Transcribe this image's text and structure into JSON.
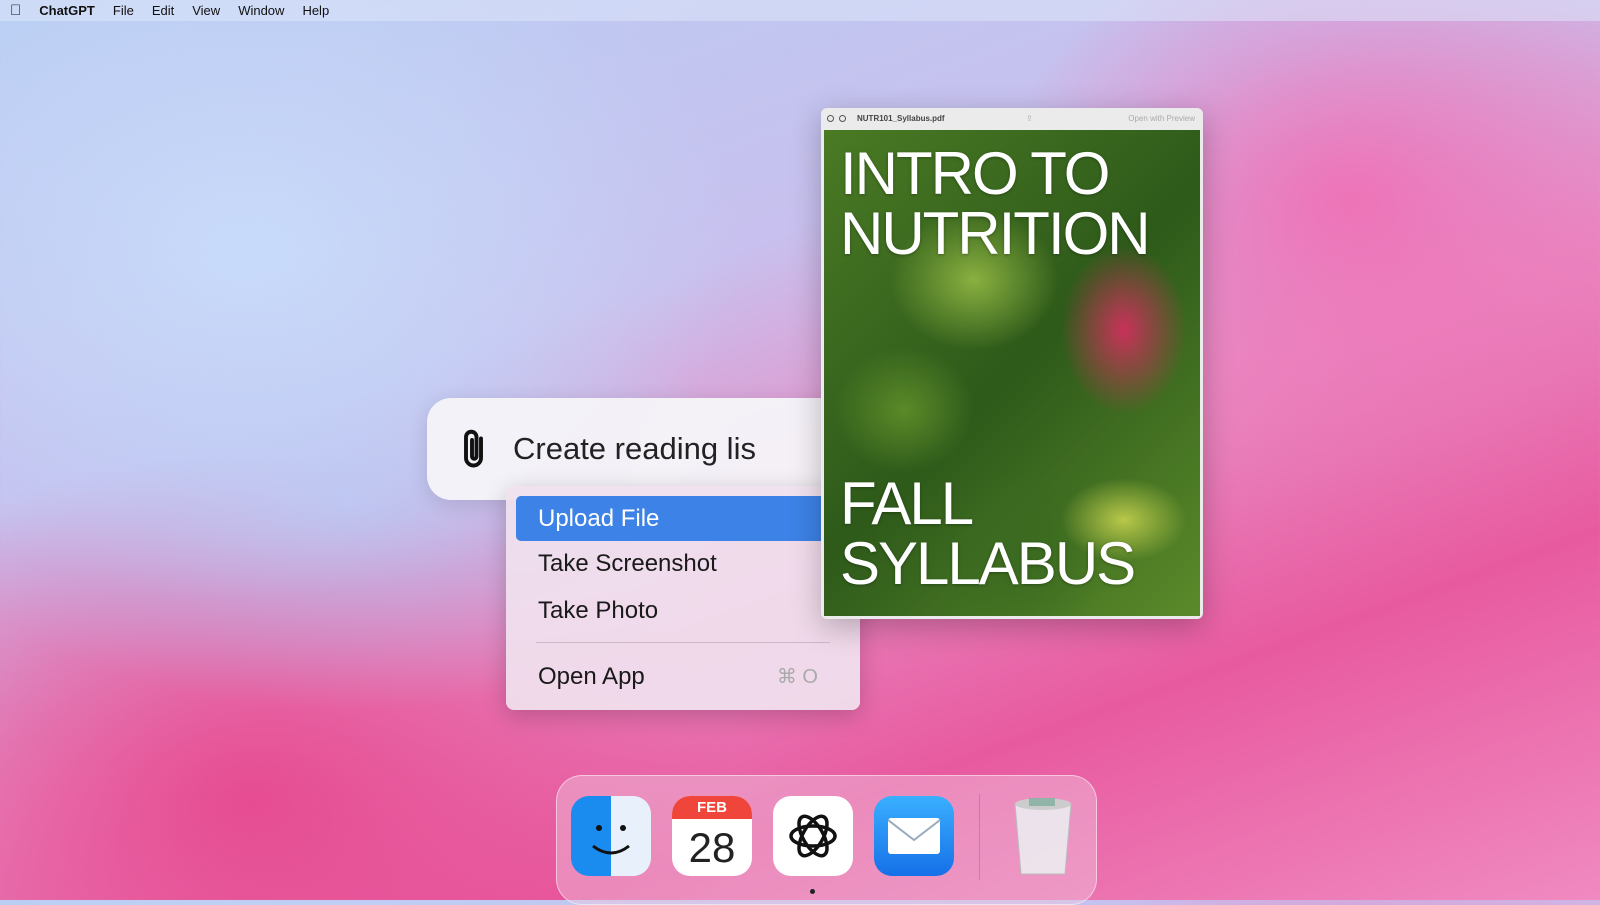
{
  "menubar": {
    "app": "ChatGPT",
    "items": [
      "File",
      "Edit",
      "View",
      "Window",
      "Help"
    ]
  },
  "prompt": {
    "text": "Create reading lis"
  },
  "attach_menu": {
    "items": [
      "Upload File",
      "Take Screenshot",
      "Take Photo"
    ],
    "open_app": "Open App",
    "open_app_shortcut": "⌘ O"
  },
  "pdf": {
    "filename": "NUTR101_Syllabus.pdf",
    "open_with": "Open with Preview",
    "cover_top": "INTRO TO NUTRITION",
    "cover_bottom": "FALL SYLLABUS"
  },
  "dock": {
    "calendar_month": "FEB",
    "calendar_day": "28",
    "apps": [
      "finder",
      "calendar",
      "chatgpt",
      "mail",
      "trash"
    ]
  }
}
